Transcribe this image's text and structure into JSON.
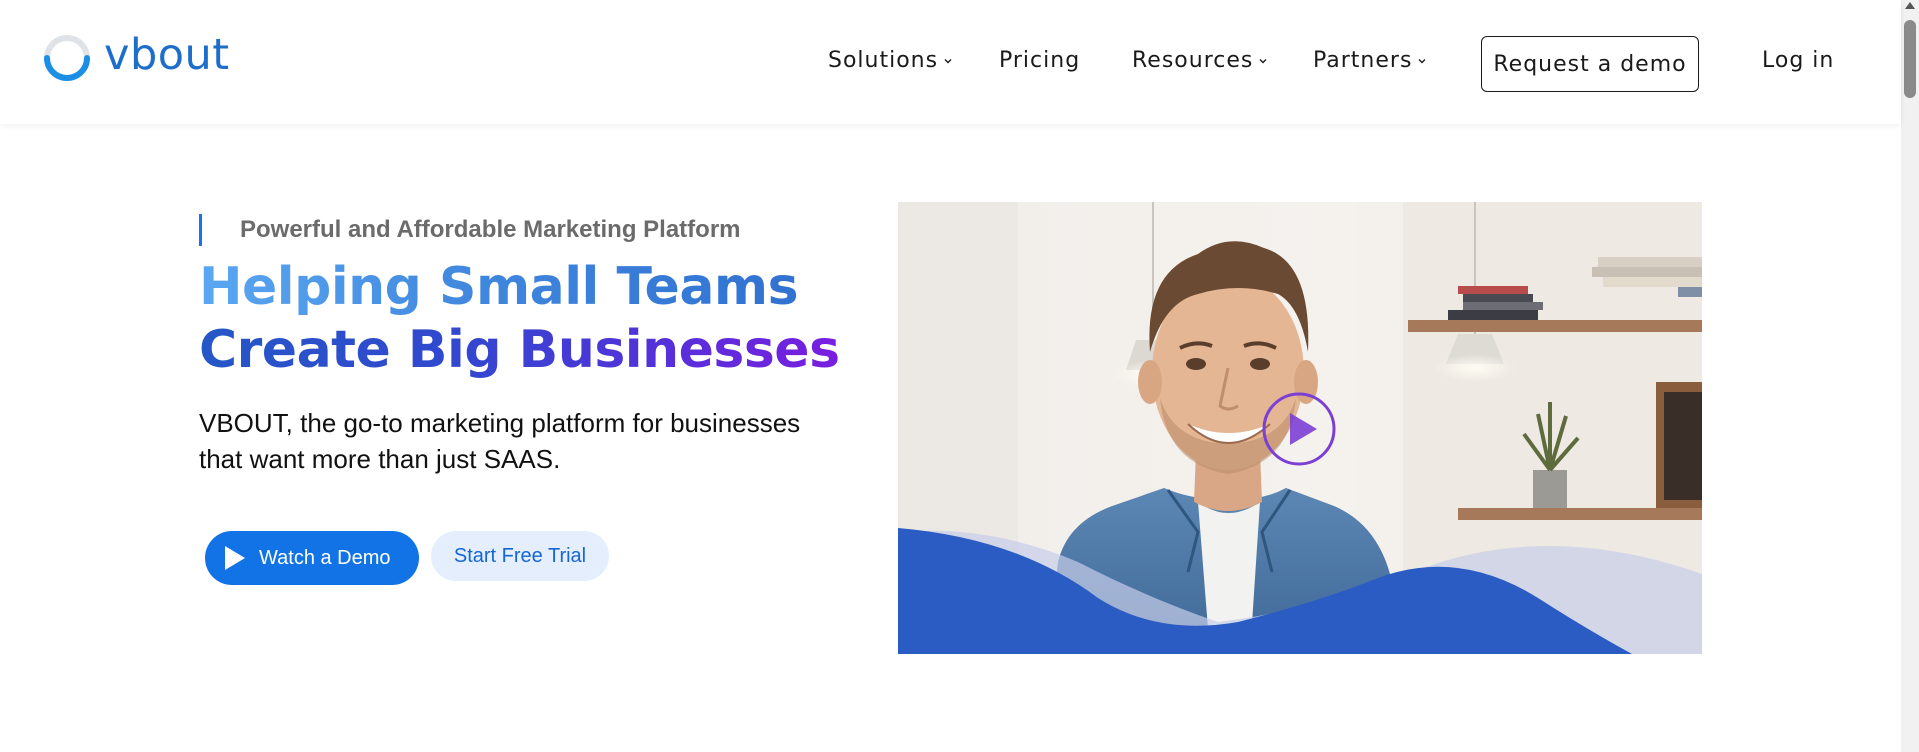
{
  "brand": {
    "logo_text": "vbout",
    "primary_color": "#1b73e8",
    "accent_purple": "#7a1ee0"
  },
  "nav": {
    "items": [
      {
        "label": "Solutions",
        "has_dropdown": true
      },
      {
        "label": "Pricing",
        "has_dropdown": false
      },
      {
        "label": "Resources",
        "has_dropdown": true
      },
      {
        "label": "Partners",
        "has_dropdown": true
      }
    ],
    "request_demo_label": "Request a demo",
    "login_label": "Log in"
  },
  "hero": {
    "eyebrow": "Powerful and Affordable Marketing Platform",
    "headline_line1": "Helping Small Teams",
    "headline_line2": "Create Big Businesses",
    "subtext": "VBOUT, the go-to marketing platform for businesses that want more than just SAAS.",
    "watch_demo_label": "Watch a Demo",
    "start_trial_label": "Start Free Trial"
  },
  "icons": {
    "logo": "vbout-ring-logo-icon",
    "chevron": "chevron-down-icon",
    "play": "play-icon",
    "video_play": "video-play-icon"
  }
}
